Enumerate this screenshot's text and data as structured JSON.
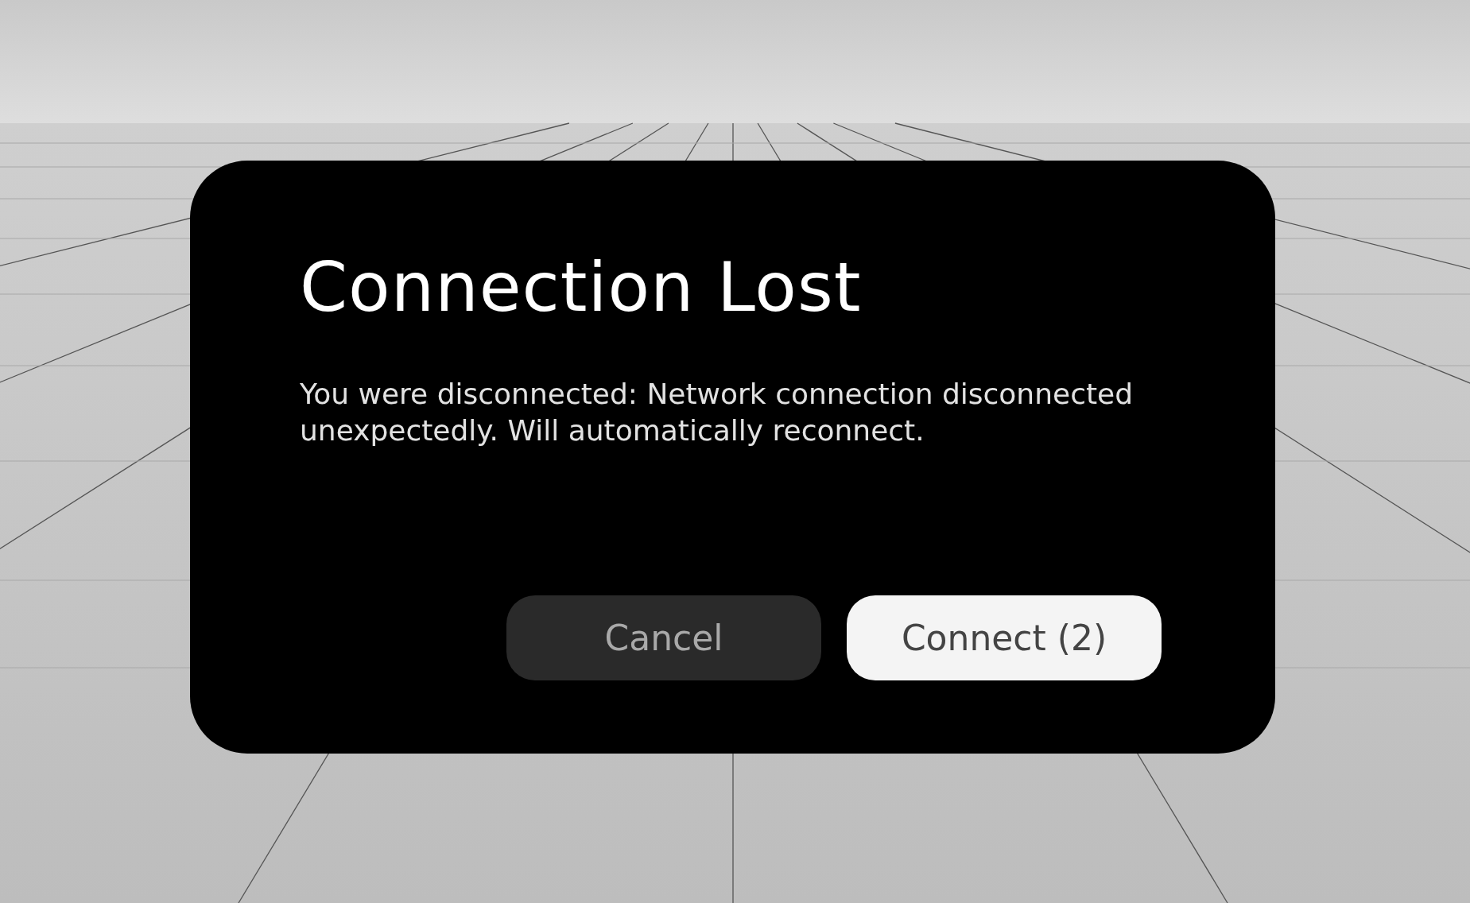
{
  "dialog": {
    "title": "Connection Lost",
    "message": "You were disconnected: Network connection disconnected unexpectedly. Will automatically reconnect.",
    "buttons": [
      {
        "label": "Cancel",
        "kind": "secondary"
      },
      {
        "label": "Connect (2)",
        "kind": "primary"
      }
    ]
  }
}
